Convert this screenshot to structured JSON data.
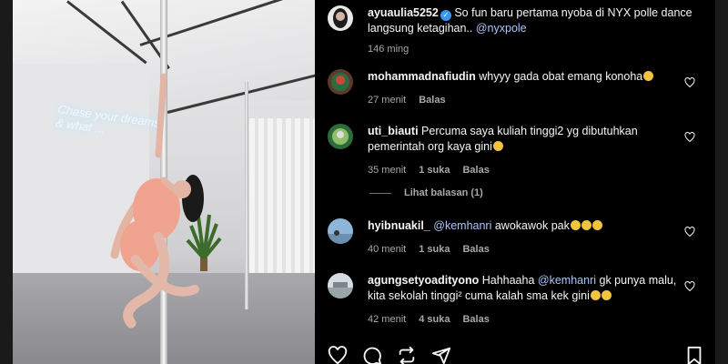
{
  "post": {
    "username": "ayuaulia5252",
    "caption": "So fun baru pertama nyoba di NYX polle dance langsung ketagihan..",
    "mention": "@nyxpole",
    "age": "146 ming"
  },
  "comments": [
    {
      "username": "mohammadnafiudin",
      "text": "whyyy gada obat emang konoha",
      "time": "27 menit",
      "reply": "Balas"
    },
    {
      "username": "uti_biauti",
      "text": "Percuma saya kuliah tinggi2 yg dibutuhkan pemerintah org kaya gini",
      "time": "35 menit",
      "likes": "1 suka",
      "reply": "Balas"
    },
    {
      "username": "hyibnuakil_",
      "mention": "@kemhanri",
      "text": "awokawok pak",
      "time": "40 menit",
      "likes": "1 suka",
      "reply": "Balas"
    },
    {
      "username": "agungsetyoadityono",
      "text_before": "Hahhaaha",
      "mention": "@kemhanri",
      "text_after": "gk punya malu, kita sekolah tinggi² cuma kalah sma kek gini",
      "time": "42 menit",
      "likes": "4 suka",
      "reply": "Balas"
    }
  ],
  "view_replies": "Lihat balasan (1)",
  "media": {
    "neon_line1": "Chase your dreams",
    "neon_line2": "& what ..."
  },
  "icons": {
    "like": "heart-icon",
    "comment": "comment-icon",
    "repost": "repost-icon",
    "share": "share-icon",
    "save": "bookmark-icon",
    "verified": "verified-badge-icon"
  },
  "colors": {
    "background": "#000000",
    "text": "#f5f5f5",
    "muted": "#a8a8a8",
    "mention": "#a8c7fa",
    "verified": "#3797f0"
  }
}
